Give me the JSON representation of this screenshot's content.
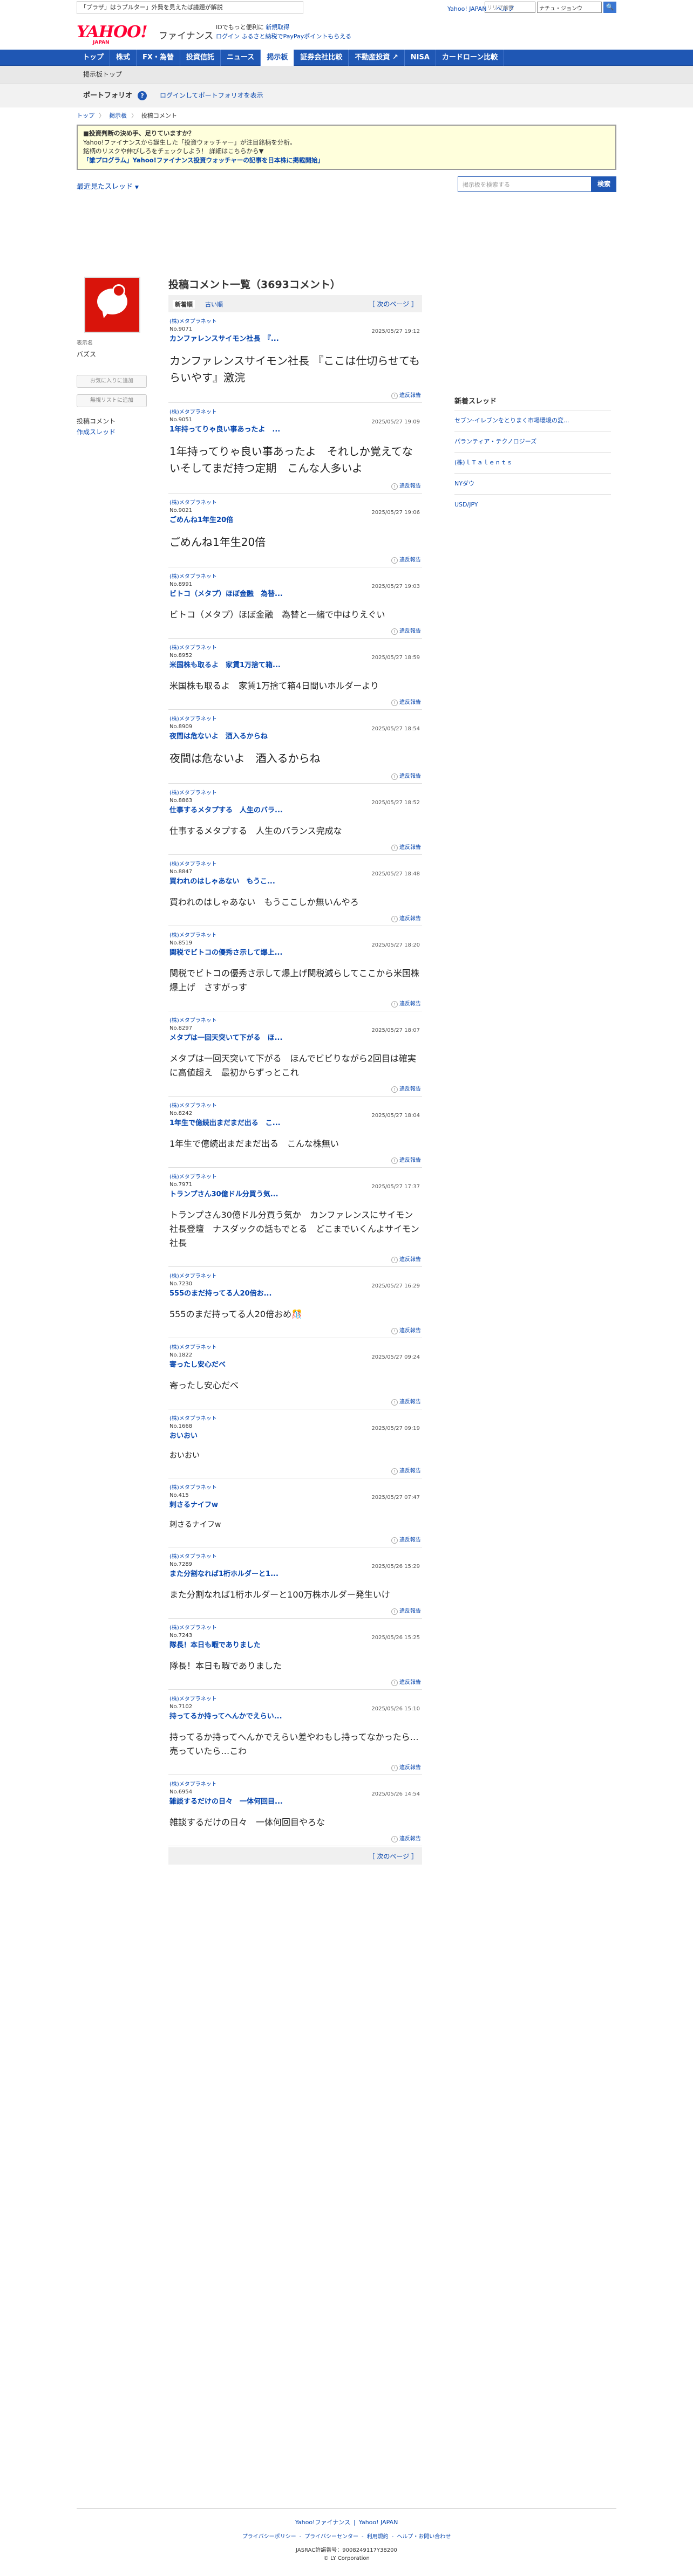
{
  "promo": {
    "text": "「プラザ」はうプルター」外費を見えたば議題が解説",
    "red": ""
  },
  "top_links": [
    "Yahoo! JAPAN",
    "ヘルプ"
  ],
  "top_search": {
    "placeholder": "リリプ検索",
    "select": "ナチュ・ジョンウ",
    "button": "🔍"
  },
  "logo": {
    "yahoo": "YAHOO!",
    "japan": "JAPAN",
    "finance": "ファイナンス"
  },
  "header_text": {
    "line1_a": "IDでもっと便利に",
    "line1_b": "新規取得",
    "line2_a": "ログイン",
    "line2_b": "ふるさと納税でPayPayポイントもらえる"
  },
  "nav": {
    "items": [
      "トップ",
      "株式",
      "FX・為替",
      "投資信託",
      "ニュース",
      "掲示板",
      "証券会社比較",
      "不動産投資 ↗",
      "NISA",
      "カードローン比較"
    ],
    "active_index": 5
  },
  "subnav": {
    "label": "掲示板トップ"
  },
  "portfolio": {
    "title": "ポートフォリオ",
    "help": "?",
    "link": "ログインしてポートフォリオを表示"
  },
  "breadcrumb": {
    "items": [
      "トップ",
      "掲示板"
    ],
    "current": "投稿コメント"
  },
  "notice": {
    "line1": "■投資判断の決め手、足りていますか？",
    "line2": "Yahoo!ファイナンスから誕生した「投資ウォッチャー」が注目銘柄を分析。",
    "line3": "銘柄のリスクや伸びしろをチェックしよう！ 詳細はこちらから▼",
    "line4": "「誰プログラム」Yahoo!ファイナンス投資ウォッチャーの記事を日本株に掲載開始」"
  },
  "tools": {
    "sort_label": "最近見たスレッド",
    "search_placeholder": "掲示板を検索する",
    "search_button": "検索"
  },
  "profile": {
    "label": "表示名",
    "name": "バズス",
    "btn_favorite": "お気に入りに追加",
    "btn_block": "無視リストに追加",
    "menu": [
      "投稿コメント",
      "作成スレッド"
    ]
  },
  "content": {
    "title": "投稿コメント一覧（3693コメント）",
    "tab_new": "新着順",
    "tab_old": "古い順",
    "next": "［ 次のページ ］",
    "report": "違反報告"
  },
  "posts": [
    {
      "user": "(株)メタプラネット",
      "no": "No.9071",
      "date": "2025/05/27 19:12",
      "title": "カンファレンスサイモン社長　『...",
      "body": "カンファレンスサイモン社長\n『ここは仕切らせてもらいやす』激浣",
      "size": "big"
    },
    {
      "user": "(株)メタプラネット",
      "no": "No.9051",
      "date": "2025/05/27 19:09",
      "title": "1年持ってりゃ良い事あったよ　...",
      "body": "1年持ってりゃ良い事あったよ　それしか覚えてないそしてまだ持つ定期　こんな人多いよ",
      "size": "big"
    },
    {
      "user": "(株)メタプラネット",
      "no": "No.9021",
      "date": "2025/05/27 19:06",
      "title": "ごめんね1年生20倍",
      "body": "ごめんね1年生20倍",
      "size": "big"
    },
    {
      "user": "(株)メタプラネット",
      "no": "No.8991",
      "date": "2025/05/27 19:03",
      "title": "ビトコ（メタプ）ほぼ金融　為替...",
      "body": "ビトコ（メタプ）ほぼ金融　為替と一緒で中はりえぐい",
      "size": "mid"
    },
    {
      "user": "(株)メタプラネット",
      "no": "No.8952",
      "date": "2025/05/27 18:59",
      "title": "米国株も取るよ　家賃1万捨て箱...",
      "body": "米国株も取るよ　家賃1万捨て箱4日間いホルダーより",
      "size": "mid"
    },
    {
      "user": "(株)メタプラネット",
      "no": "No.8909",
      "date": "2025/05/27 18:54",
      "title": "夜間は危ないよ　酒入るからね",
      "body": "夜間は危ないよ　酒入るからね",
      "size": "big"
    },
    {
      "user": "(株)メタプラネット",
      "no": "No.8863",
      "date": "2025/05/27 18:52",
      "title": "仕事するメタプする　人生のバラ...",
      "body": "仕事するメタプする　人生のバランス完成な",
      "size": "mid"
    },
    {
      "user": "(株)メタプラネット",
      "no": "No.8847",
      "date": "2025/05/27 18:48",
      "title": "買われのはしゃあない　もうこ...",
      "body": "買われのはしゃあない　もうここしか無いんやろ",
      "size": "mid"
    },
    {
      "user": "(株)メタプラネット",
      "no": "No.8519",
      "date": "2025/05/27 18:20",
      "title": "関税でビトコの優秀さ示して爆上...",
      "body": "関税でビトコの優秀さ示して爆上げ関税減らしてここから米国株爆上げ　さすがっす",
      "size": "mid"
    },
    {
      "user": "(株)メタプラネット",
      "no": "No.8297",
      "date": "2025/05/27 18:07",
      "title": "メタプは一回天突いて下がる　ほ...",
      "body": "メタプは一回天突いて下がる　ほんでビビりながら2回目は確実に高値超え　最初からずっとこれ",
      "size": "mid"
    },
    {
      "user": "(株)メタプラネット",
      "no": "No.8242",
      "date": "2025/05/27 18:04",
      "title": "1年生で億続出まだまだ出る　こ...",
      "body": "1年生で億続出まだまだ出る　こんな株無い",
      "size": "mid"
    },
    {
      "user": "(株)メタプラネット",
      "no": "No.7971",
      "date": "2025/05/27 17:37",
      "title": "トランプさん30億ドル分買う気...",
      "body": "トランプさん30億ドル分買う気か　カンファレンスにサイモン社長登壇　ナスダックの話もでとる　どこまでいくんよサイモン社長",
      "size": "mid"
    },
    {
      "user": "(株)メタプラネット",
      "no": "No.7230",
      "date": "2025/05/27 16:29",
      "title": "555のまだ持ってる人20倍お...",
      "body": "555のまだ持ってる人20倍おめ🎊",
      "size": "mid"
    },
    {
      "user": "(株)メタプラネット",
      "no": "No.1822",
      "date": "2025/05/27 09:24",
      "title": "寄ったし安心だべ",
      "body": "寄ったし安心だべ",
      "size": "mid"
    },
    {
      "user": "(株)メタプラネット",
      "no": "No.1668",
      "date": "2025/05/27 09:19",
      "title": "おいおい",
      "body": "おいおい",
      "size": "sm"
    },
    {
      "user": "(株)メタプラネット",
      "no": "No.415",
      "date": "2025/05/27 07:47",
      "title": "刺さるナイフw",
      "body": "刺さるナイフw",
      "size": "sm"
    },
    {
      "user": "(株)メタプラネット",
      "no": "No.7289",
      "date": "2025/05/26 15:29",
      "title": "また分割なれば1桁ホルダーと1...",
      "body": "また分割なれば1桁ホルダーと100万株ホルダー発生いけ",
      "size": "mid"
    },
    {
      "user": "(株)メタプラネット",
      "no": "No.7243",
      "date": "2025/05/26 15:25",
      "title": "隊長！本日も暇でありました",
      "body": "隊長！本日も暇でありました",
      "size": "mid"
    },
    {
      "user": "(株)メタプラネット",
      "no": "No.7102",
      "date": "2025/05/26 15:10",
      "title": "持ってるか持ってへんかでえらい...",
      "body": "持ってるか持ってへんかでえらい差やわもし持ってなかったら…売っていたら…こわ",
      "size": "mid"
    },
    {
      "user": "(株)メタプラネット",
      "no": "No.6954",
      "date": "2025/05/26 14:54",
      "title": "雑談するだけの日々　一体何回目...",
      "body": "雑談するだけの日々　一体何回目やろな",
      "size": "mid"
    }
  ],
  "right": {
    "title": "新着スレッド",
    "items": [
      "セブン-イレブンをとりまく市場環境の変...",
      "パランティア・テクノロジーズ",
      "(株)ｌＴａｌｅｎｔｓ",
      "NYダウ",
      "USD/JPY"
    ]
  },
  "footer": {
    "line1": [
      "Yahoo!ファイナンス",
      "Yahoo! JAPAN"
    ],
    "line2": [
      "プライバシーポリシー",
      "プライバシーセンター",
      "利用規約",
      "ヘルプ・お問い合わせ"
    ],
    "line3": "JASRAC許諾番号：9008249117Y38200",
    "line4": "© LY Corporation"
  }
}
